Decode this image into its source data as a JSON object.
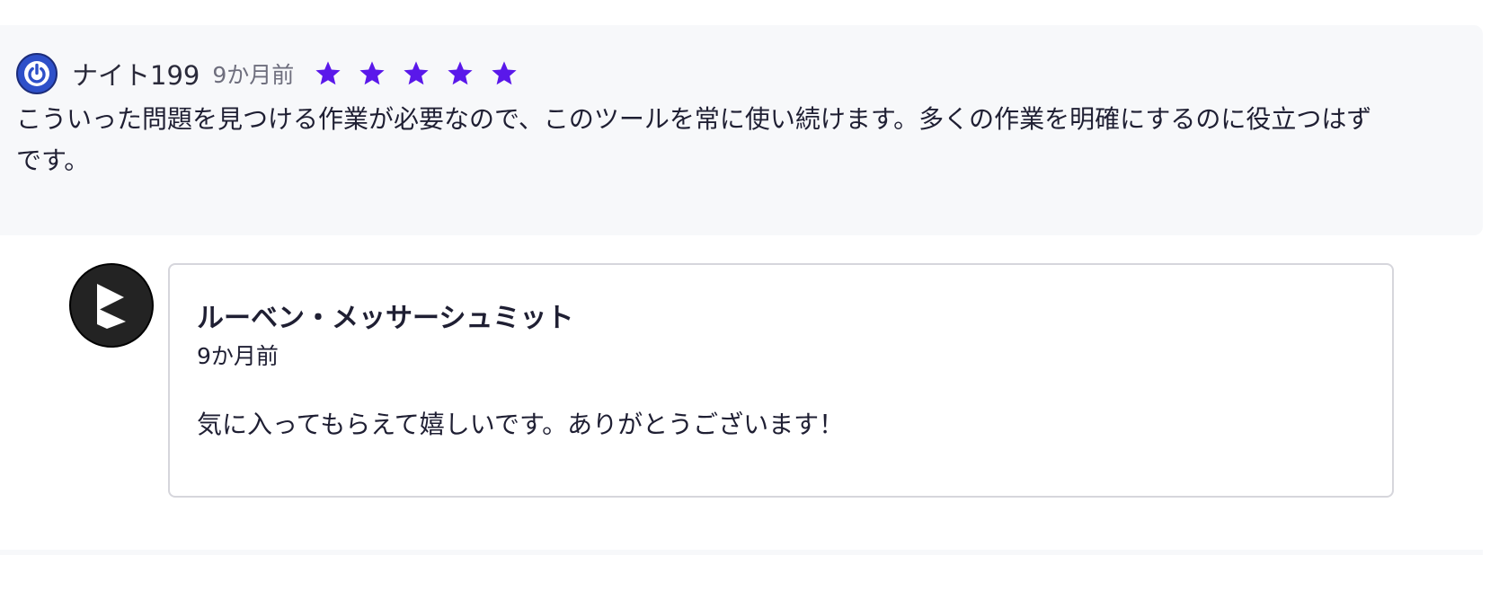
{
  "review": {
    "reviewer_name": "ナイト199",
    "time": "9か月前",
    "rating": 5,
    "rating_max": 5,
    "star_color": "#5a18ea",
    "avatar_icon": "power-icon",
    "avatar_color": "#2e50c9",
    "body": "こういった問題を見つける作業が必要なので、このツールを常に使い続けます。多くの作業を明確にするのに役立つはずです。"
  },
  "reply": {
    "author": "ルーベン・メッサーシュミット",
    "time": "9か月前",
    "avatar_icon": "brand-logo-icon",
    "body": "気に入ってもらえて嬉しいです。ありがとうございます！"
  }
}
